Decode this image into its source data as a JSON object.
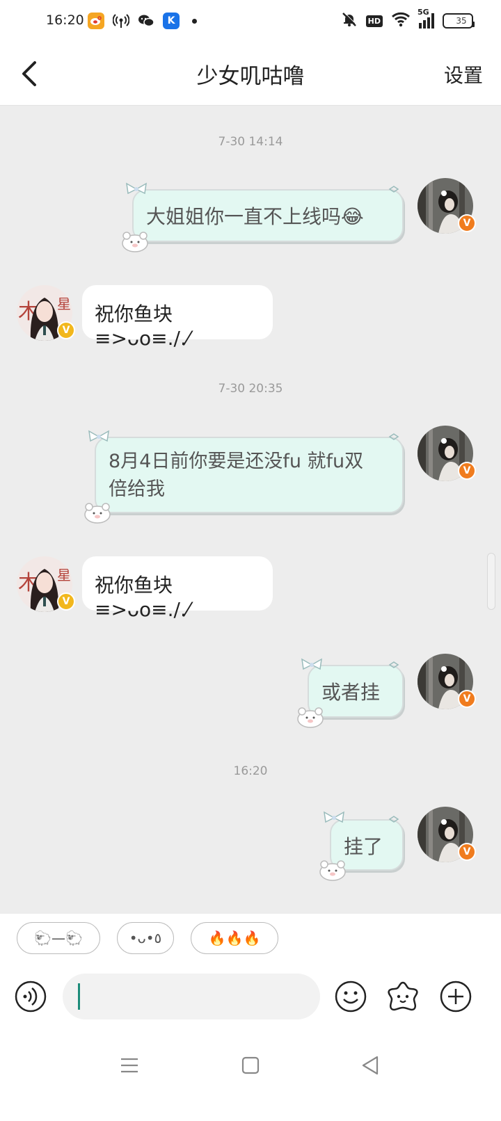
{
  "status_bar": {
    "time": "16:20",
    "battery": "35",
    "network": "5G",
    "hd": "HD",
    "icons": [
      "weibo-icon",
      "hotspot-icon",
      "wechat-icon",
      "k-app-icon",
      "notification-dot",
      "mute-icon",
      "wifi-icon",
      "signal-icon",
      "battery-icon"
    ]
  },
  "header": {
    "title": "少女叽咕噜",
    "settings_label": "设置",
    "back_icon": "chevron-left-icon"
  },
  "messages": [
    {
      "type": "time",
      "text": "7-30 14:14"
    },
    {
      "type": "out",
      "text": "大姐姐你一直不上线吗",
      "emoji": "😂"
    },
    {
      "type": "in",
      "text": "祝你鱼块≡>ᴗo≡./.⁄"
    },
    {
      "type": "time",
      "text": "7-30 20:35"
    },
    {
      "type": "out",
      "line1": "8月4日前你要是还没fu 就fu双",
      "line2": "倍给我"
    },
    {
      "type": "in",
      "text": "祝你鱼块≡>ᴗo≡./.⁄"
    },
    {
      "type": "out",
      "text": "或者挂"
    },
    {
      "type": "time",
      "text": "16:20"
    },
    {
      "type": "out",
      "text": "挂了"
    }
  ],
  "badges": {
    "self": "V",
    "other": "V"
  },
  "quick_replies": [
    "🐑—🐑",
    "•ᴗ•٥",
    "🔥🔥🔥"
  ],
  "input": {
    "placeholder": "",
    "value": ""
  },
  "input_icons": [
    "voice-icon",
    "emoji-icon",
    "sticker-icon",
    "plus-icon"
  ],
  "colors": {
    "out_bubble": "#e3f8f2",
    "in_bubble": "#ffffff",
    "badge_self": "#f07c1e",
    "badge_other": "#f2b71c",
    "background": "#ededed"
  },
  "nav_icons": [
    "menu-icon",
    "home-icon",
    "back-icon"
  ]
}
